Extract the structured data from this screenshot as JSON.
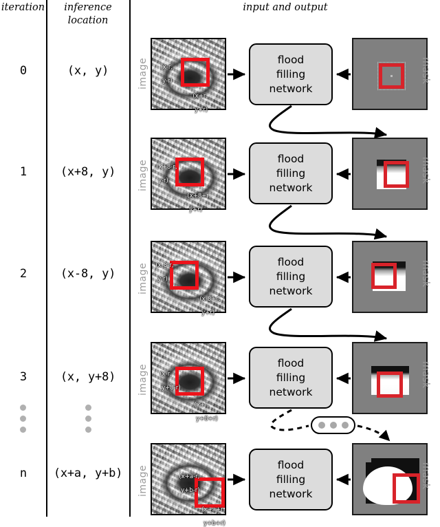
{
  "headers": {
    "iteration": "iteration",
    "inference_location": "inference\nlocation",
    "inference_location_line1": "inference",
    "inference_location_line2": "location",
    "input_and_output": "input and output"
  },
  "labels": {
    "image": "image",
    "mask": "mask",
    "network_line1": "flood",
    "network_line2": "filling",
    "network_line3": "network",
    "ellipsis": "• • •"
  },
  "colors": {
    "roi_red": "#d8232a",
    "mask_gray": "#808080",
    "network_fill": "#dcdcdc",
    "dots_gray": "#a8a8a8",
    "side_label_gray": "#9a9a9a",
    "rule_black": "#000000"
  },
  "rows": [
    {
      "iteration": "0",
      "location": "(x, y)",
      "image_coord_topleft": "(x-r,\n y-r)",
      "image_coord_topleft_l1": "(x-r,",
      "image_coord_topleft_l2": " y-r)",
      "image_coord_bottomright": "(x+r,\n y+r)",
      "image_coord_bottomright_l1": "(x+r,",
      "image_coord_bottomright_l2": " y+r)",
      "image_label": "image",
      "mask_label": "mask",
      "network_label": "flood filling network"
    },
    {
      "iteration": "1",
      "location": "(x+8, y)",
      "image_coord_topleft": "(x+8-r,\n y-r)",
      "image_coord_topleft_l1": "(x+8-r,",
      "image_coord_topleft_l2": " y-r)",
      "image_coord_bottomright": "(x+8+r,\n y+r)",
      "image_coord_bottomright_l1": "(x+8+r,",
      "image_coord_bottomright_l2": " y+r)",
      "image_label": "image",
      "mask_label": "mask",
      "network_label": "flood filling network"
    },
    {
      "iteration": "2",
      "location": "(x-8, y)",
      "image_coord_topleft": "(x-8-r,\n y-r)",
      "image_coord_topleft_l1": "(x-8-r,",
      "image_coord_topleft_l2": " y-r)",
      "image_coord_bottomright": "(x-8+r,\n y+r)",
      "image_coord_bottomright_l1": "(x-8+r,",
      "image_coord_bottomright_l2": " y+r)",
      "image_label": "image",
      "mask_label": "mask",
      "network_label": "flood filling network"
    },
    {
      "iteration": "3",
      "location": "(x, y+8)",
      "image_coord_topleft": "(x-r,\n y+8-r)",
      "image_coord_topleft_l1": "(x-r,",
      "image_coord_topleft_l2": " y+8-r)",
      "image_coord_bottomright": "(x+r,\n y+8+r)",
      "image_coord_bottomright_l1": "(x+r,",
      "image_coord_bottomright_l2": " y+8+r)",
      "image_label": "image",
      "mask_label": "mask",
      "network_label": "flood filling network"
    },
    {
      "iteration": "n",
      "location": "(x+a, y+b)",
      "image_coord_topleft": "(x+a-r,\n y+b-r)",
      "image_coord_topleft_l1": "(x+a-r,",
      "image_coord_topleft_l2": " y+b-r)",
      "image_coord_bottomright": "(x+a+r,\n y+b+r)",
      "image_coord_bottomright_l1": "(x+a+r,",
      "image_coord_bottomright_l2": " y+b+r)",
      "image_label": "image",
      "mask_label": "mask",
      "network_label": "flood filling network"
    }
  ]
}
